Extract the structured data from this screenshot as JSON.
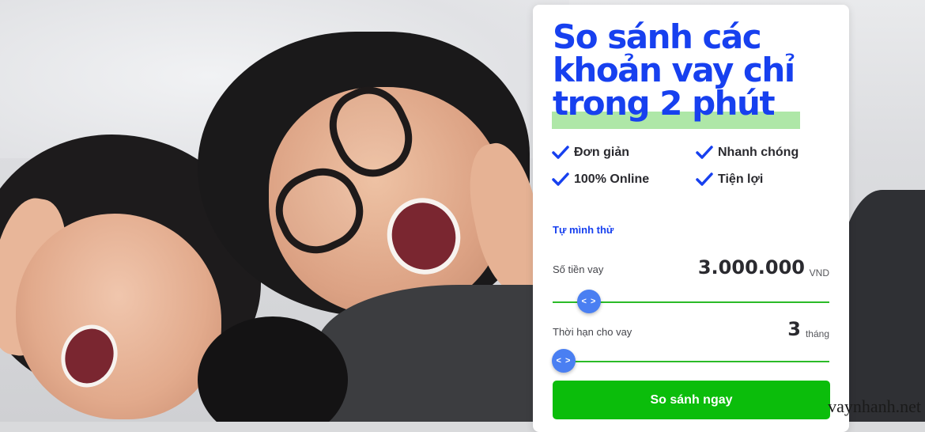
{
  "card": {
    "headline_line1": "So sánh các",
    "headline_line2": "khoản vay chỉ",
    "headline_line3": "trong 2 phút",
    "features": [
      {
        "label": "Đơn giản",
        "icon": "check-icon"
      },
      {
        "label": "Nhanh chóng",
        "icon": "check-icon"
      },
      {
        "label": "100% Online",
        "icon": "check-icon"
      },
      {
        "label": "Tiện lợi",
        "icon": "check-icon"
      }
    ],
    "try_link": "Tự mình thử",
    "amount": {
      "label": "Số tiền vay",
      "value": "3.000.000",
      "unit": "VND",
      "slider_fraction": 0.1
    },
    "term": {
      "label": "Thời hạn cho vay",
      "value": "3",
      "unit": "tháng",
      "slider_fraction": 0.0
    },
    "slider_handle_glyph": "< >",
    "submit_label": "So sánh ngay"
  },
  "watermark": "vaynhanh.net",
  "colors": {
    "brand_blue": "#1740ef",
    "highlight_green": "#aee7a7",
    "button_green": "#0bbd0b",
    "slider_green": "#2bbb28",
    "handle_blue": "#4a7ff2"
  }
}
